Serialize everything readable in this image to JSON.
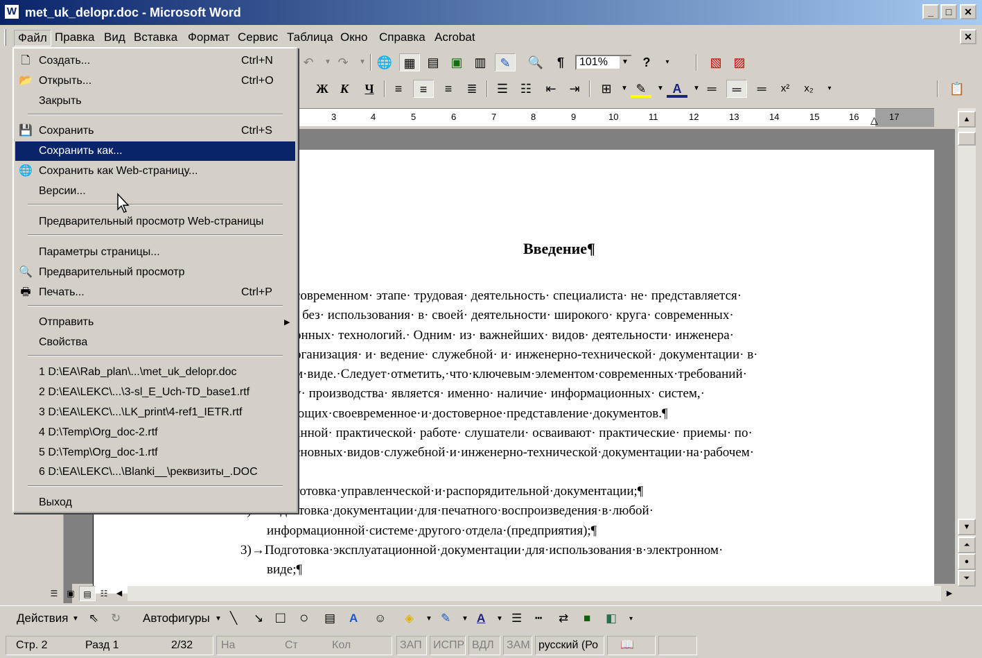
{
  "window": {
    "title": "met_uk_delopr.doc - Microsoft Word",
    "app_icon": "word-icon"
  },
  "menubar": {
    "items": [
      "Файл",
      "Правка",
      "Вид",
      "Вставка",
      "Формат",
      "Сервис",
      "Таблица",
      "Окно",
      "Справка",
      "Acrobat"
    ],
    "active": "Файл"
  },
  "toolbar": {
    "zoom": "101%",
    "format_buttons": [
      "Ж",
      "К",
      "Ч"
    ]
  },
  "file_menu": {
    "items": [
      {
        "label": "Создать...",
        "shortcut": "Ctrl+N",
        "icon": "new-document-icon"
      },
      {
        "label": "Открыть...",
        "shortcut": "Ctrl+O",
        "icon": "open-folder-icon"
      },
      {
        "label": "Закрыть",
        "shortcut": "",
        "icon": ""
      },
      {
        "label": "Сохранить",
        "shortcut": "Ctrl+S",
        "icon": "save-icon"
      },
      {
        "label": "Сохранить как...",
        "shortcut": "",
        "icon": "",
        "highlighted": true
      },
      {
        "label": "Сохранить как Web-страницу...",
        "shortcut": "",
        "icon": "save-web-icon"
      },
      {
        "label": "Версии...",
        "shortcut": "",
        "icon": ""
      },
      {
        "label": "Предварительный просмотр Web-страницы",
        "shortcut": "",
        "icon": ""
      },
      {
        "label": "Параметры страницы...",
        "shortcut": "",
        "icon": ""
      },
      {
        "label": "Предварительный просмотр",
        "shortcut": "",
        "icon": "print-preview-icon"
      },
      {
        "label": "Печать...",
        "shortcut": "Ctrl+P",
        "icon": "print-icon"
      },
      {
        "label": "Отправить",
        "shortcut": "",
        "icon": "",
        "submenu": true
      },
      {
        "label": "Свойства",
        "shortcut": "",
        "icon": ""
      },
      {
        "label": "1 D:\\EA\\Rab_plan\\...\\met_uk_delopr.doc",
        "shortcut": "",
        "icon": ""
      },
      {
        "label": "2 D:\\EA\\LEKC\\...\\3-sl_E_Uch-TD_base1.rtf",
        "shortcut": "",
        "icon": ""
      },
      {
        "label": "3 D:\\EA\\LEKC\\...\\LK_print\\4-ref1_IETR.rtf",
        "shortcut": "",
        "icon": ""
      },
      {
        "label": "4 D:\\Temp\\Org_doc-2.rtf",
        "shortcut": "",
        "icon": ""
      },
      {
        "label": "5 D:\\Temp\\Org_doc-1.rtf",
        "shortcut": "",
        "icon": ""
      },
      {
        "label": "6 D:\\EA\\LEKC\\...\\Blanki__\\реквизиты_.DOC",
        "shortcut": "",
        "icon": ""
      },
      {
        "label": "Выход",
        "shortcut": "",
        "icon": ""
      }
    ]
  },
  "ruler": {
    "ticks": [
      "3",
      "4",
      "5",
      "6",
      "7",
      "8",
      "9",
      "10",
      "11",
      "12",
      "13",
      "14",
      "15",
      "16",
      "17"
    ]
  },
  "document": {
    "heading": "Введение¶",
    "lines": [
      "современном· этапе· трудовая· деятельность· специалиста· не· представляется·",
      "· без· использования· в· своей· деятельности· широкого· круга· современных·",
      "онных· технологий.· Одним· из· важнейших· видов· деятельности· инженера·",
      "рганизация· и· ведение· служебной· и· инженерно-технической· документации· в·",
      "м·виде.·Следует·отметить,·что·ключевым·элементом·современных·требований·",
      "у· производства· является· именно· наличие· информационных· систем,·",
      "ющих·своевременное·и·достоверное·представление·документов.¶",
      "анной· практической· работе· слушатели· осваивают· практические· приемы· по·",
      "сновных·видов·служебной·и·инженерно-технической·документации·на·рабочем·",
      "готовка·управленческой·и·распорядительной·документации;¶",
      "2)→Подготовка·документации·для·печатного·воспроизведения·в·любой·",
      "информационной·системе·другого·отдела·(предприятия);¶",
      "3)→Подготовка·эксплуатационной·документации·для·использования·в·электронном·",
      "виде;¶"
    ]
  },
  "drawing_toolbar": {
    "actions_label": "Действия",
    "autoshapes_label": "Автофигуры"
  },
  "status": {
    "page": "Стр. 2",
    "section": "Разд 1",
    "pages": "2/32",
    "at": "На",
    "line": "Ст",
    "col": "Кол",
    "rec": "ЗАП",
    "trk": "ИСПР",
    "ext": "ВДЛ",
    "ovr": "ЗАМ",
    "language": "русский (Ро"
  }
}
